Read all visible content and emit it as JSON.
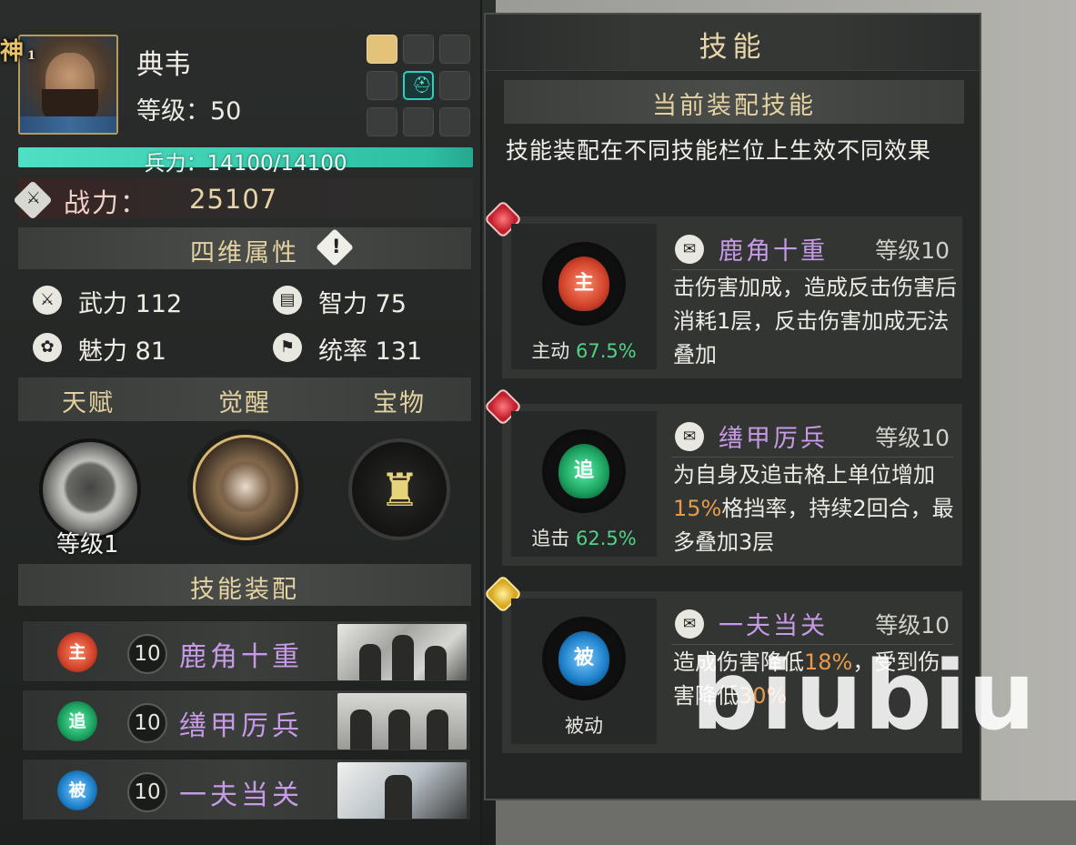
{
  "hero": {
    "badge": "神",
    "badge_num": "1",
    "name": "典韦",
    "level": "等级：50",
    "troops": "兵力：14100/14100",
    "power_label": "战力：",
    "power_value": "25107"
  },
  "attributes": {
    "title": "四维属性",
    "stats": [
      {
        "label": "武力 112",
        "icon": "sword-icon"
      },
      {
        "label": "智力 75",
        "icon": "book-icon"
      },
      {
        "label": "魅力 81",
        "icon": "flower-icon"
      },
      {
        "label": "统率 131",
        "icon": "flag-icon"
      }
    ]
  },
  "tabs": [
    "天赋",
    "觉醒",
    "宝物"
  ],
  "talent_level": "等级1",
  "skills_section": {
    "title": "技能装配",
    "skills": [
      {
        "type_char": "主",
        "level": "10",
        "name": "鹿角十重"
      },
      {
        "type_char": "追",
        "level": "10",
        "name": "缮甲厉兵"
      },
      {
        "type_char": "被",
        "level": "10",
        "name": "一夫当关"
      }
    ]
  },
  "skill_panel": {
    "title": "技能",
    "subtitle": "当前装配技能",
    "description": "技能装配在不同技能栏位上生效不同效果",
    "cards": [
      {
        "flame_char": "主",
        "type": "主动",
        "pct": "67.5%",
        "name": "鹿角十重",
        "level": "等级10",
        "desc": "击伤害加成，造成反击伤害后消耗1层，反击伤害加成无法叠加"
      },
      {
        "flame_char": "追",
        "type": "追击",
        "pct": "62.5%",
        "name": "缮甲厉兵",
        "level": "等级10",
        "desc_a": "为自身及追击格上单位增加",
        "desc_hl": "15%",
        "desc_b": "格挡率，持续2回合，最多叠加3层"
      },
      {
        "flame_char": "被",
        "type": "被动",
        "pct": "",
        "name": "一夫当关",
        "level": "等级10",
        "desc_a": "造成伤害降低",
        "desc_hl1": "18%",
        "desc_b": "，受到伤害降低",
        "desc_hl2": "30%"
      }
    ]
  },
  "watermark": "biubiu",
  "colors": {
    "skill_name": "#c79ae8",
    "percent_green": "#4ed484",
    "highlight_orange": "#e89a4a",
    "troop_bar": "#4fe0c4",
    "header_gold": "#e5d2a2"
  }
}
